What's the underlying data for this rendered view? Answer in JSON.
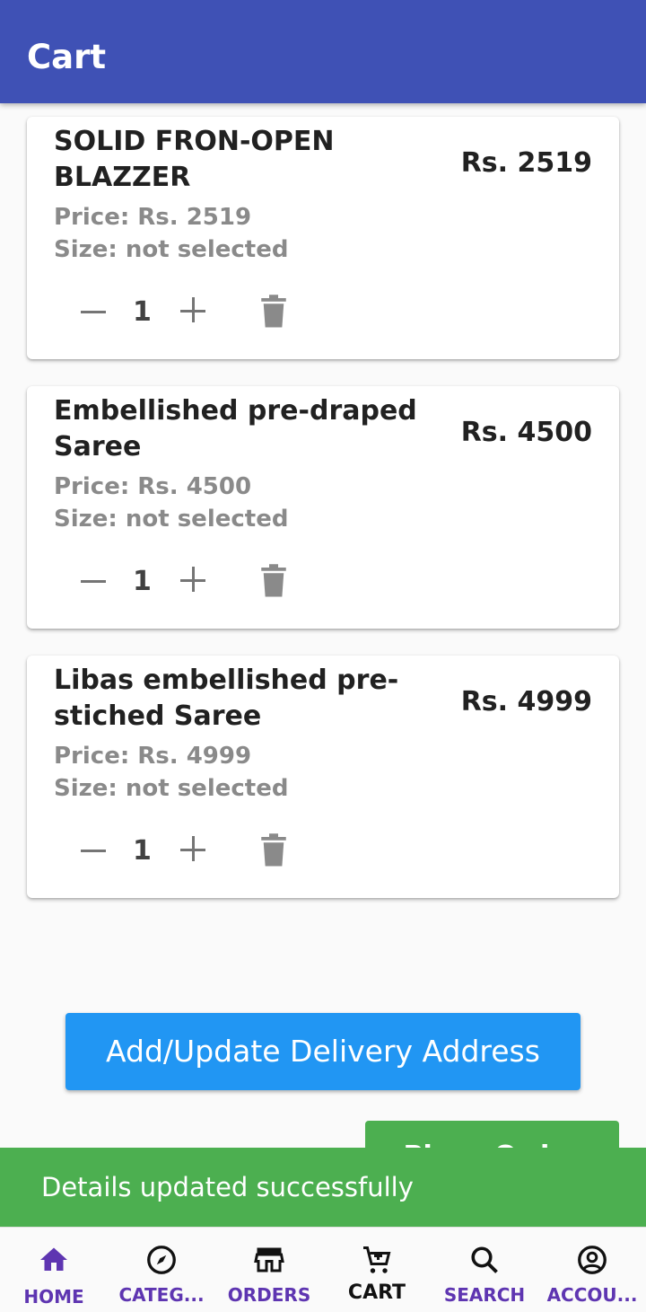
{
  "app_bar": {
    "title": "Cart"
  },
  "cart_items": [
    {
      "name": "SOLID FRON-OPEN BLAZZER",
      "total": "Rs. 2519",
      "price": "Price: Rs. 2519",
      "size": "Size: not selected",
      "quantity": "1"
    },
    {
      "name": "Embellished pre-draped Saree",
      "total": "Rs. 4500",
      "price": "Price: Rs. 4500",
      "size": "Size: not selected",
      "quantity": "1"
    },
    {
      "name": "Libas embellished pre-stiched Saree",
      "total": "Rs. 4999",
      "price": "Price: Rs. 4999",
      "size": "Size: not selected",
      "quantity": "1"
    }
  ],
  "actions": {
    "address_button": "Add/Update Delivery Address",
    "place_order_button": "Place Order"
  },
  "snackbar": {
    "message": "Details updated successfully"
  },
  "bottom_nav": [
    {
      "label": "HOME",
      "icon": "home-icon",
      "active": false
    },
    {
      "label": "CATEG...",
      "icon": "compass-icon",
      "active": false
    },
    {
      "label": "ORDERS",
      "icon": "store-icon",
      "active": false
    },
    {
      "label": "CART",
      "icon": "cart-icon",
      "active": true
    },
    {
      "label": "SEARCH",
      "icon": "search-icon",
      "active": false
    },
    {
      "label": "ACCOU...",
      "icon": "account-circle-icon",
      "active": false
    }
  ],
  "colors": {
    "app_bar": "#3f51b5",
    "primary_button": "#2196f3",
    "success": "#4caf50",
    "nav_label": "#5e35b1"
  }
}
